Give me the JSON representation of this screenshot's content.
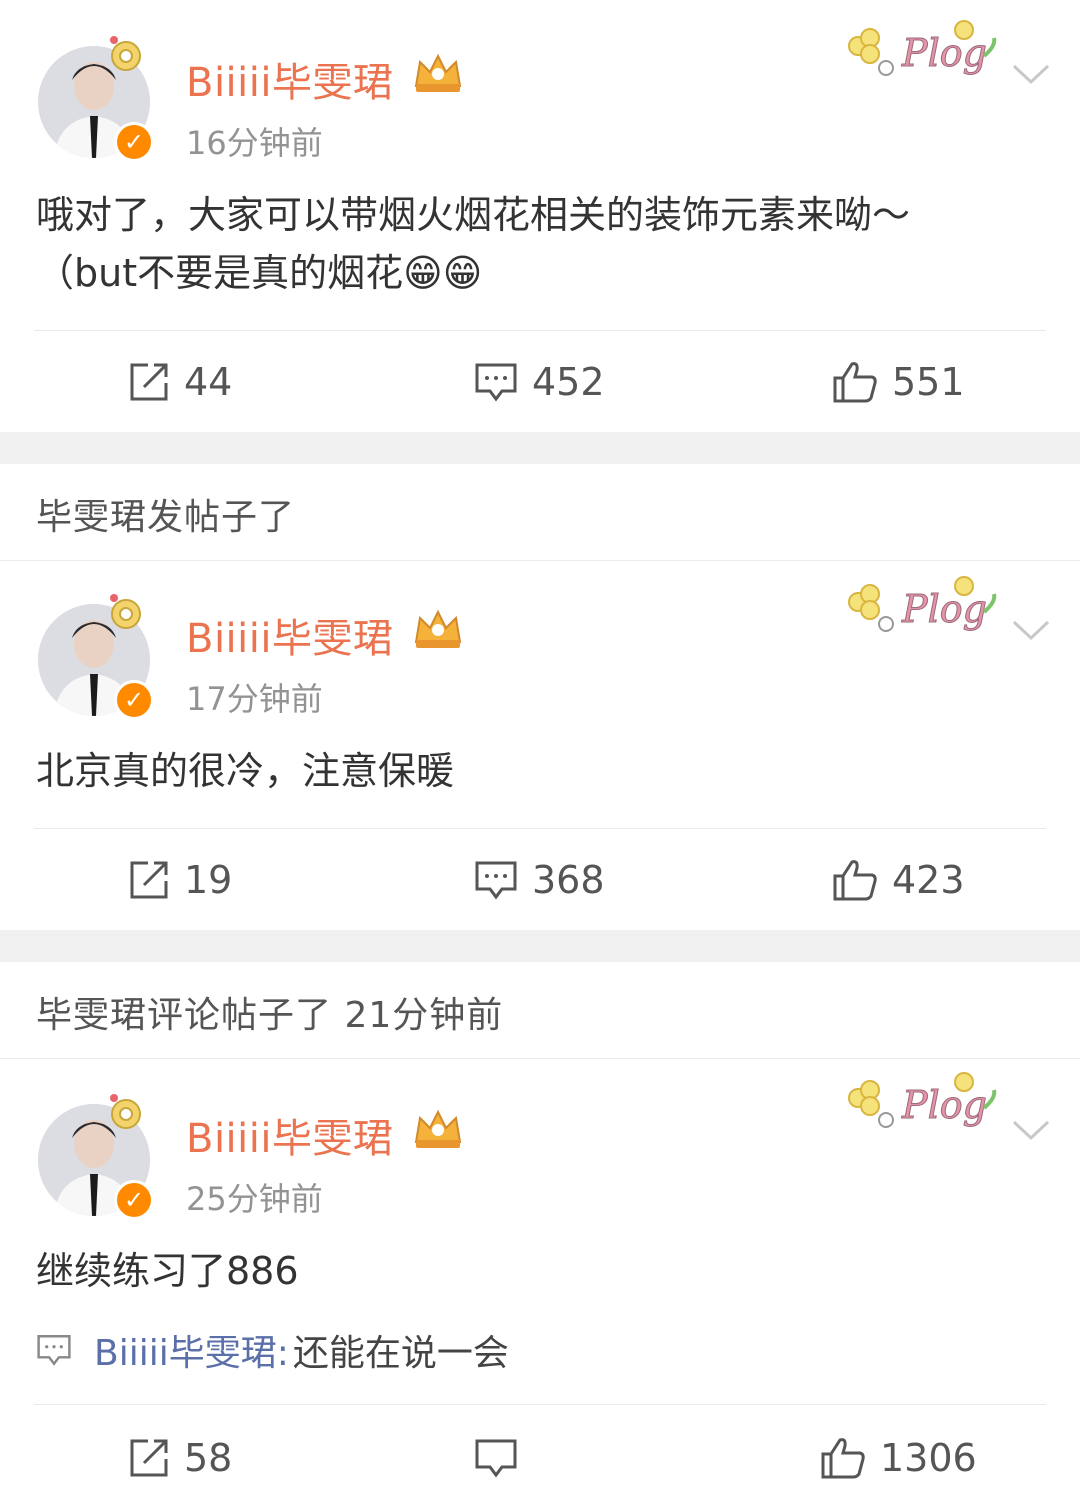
{
  "posts": [
    {
      "username": "Biiiii毕雯珺",
      "time": "16分钟前",
      "content_line1": "哦对了，大家可以带烟火烟花相关的装饰元素来呦～",
      "content_line2": "（but不要是真的烟花😁😁",
      "repost_count": "44",
      "comment_count": "452",
      "like_count": "551"
    },
    {
      "section_label": "毕雯珺发帖子了",
      "username": "Biiiii毕雯珺",
      "time": "17分钟前",
      "content_line1": "北京真的很冷，注意保暖",
      "repost_count": "19",
      "comment_count": "368",
      "like_count": "423"
    },
    {
      "section_label": "毕雯珺评论帖子了 21分钟前",
      "username": "Biiiii毕雯珺",
      "time": "25分钟前",
      "content_line1": "继续练习了886",
      "comment_user": "Biiiii毕雯珺:",
      "comment_text": "还能在说一会",
      "repost_count": "58",
      "comment_count": "",
      "like_count": "1306"
    }
  ],
  "colors": {
    "username": "#eb7350",
    "accent_orange": "#ff8a00",
    "separator": "#f0f0f0",
    "comment_user": "#5b6fa8"
  }
}
